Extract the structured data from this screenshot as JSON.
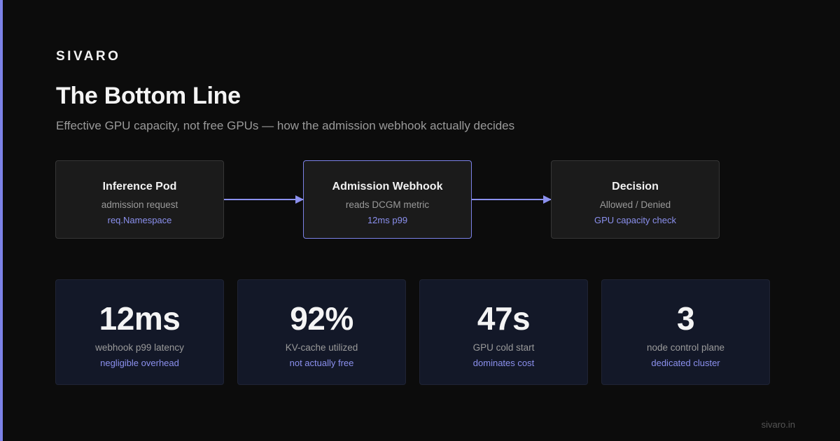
{
  "brand": "SIVARO",
  "title": "The Bottom Line",
  "subtitle": "Effective GPU capacity, not free GPUs — how the admission webhook actually decides",
  "flow": {
    "nodes": [
      {
        "title": "Inference Pod",
        "desc": "admission request",
        "note": "req.Namespace"
      },
      {
        "title": "Admission Webhook",
        "desc": "reads DCGM metric",
        "note": "12ms p99"
      },
      {
        "title": "Decision",
        "desc": "Allowed / Denied",
        "note": "GPU capacity check"
      }
    ]
  },
  "stats": [
    {
      "value": "12ms",
      "label": "webhook p99 latency",
      "note": "negligible overhead"
    },
    {
      "value": "92%",
      "label": "KV-cache utilized",
      "note": "not actually free"
    },
    {
      "value": "47s",
      "label": "GPU cold start",
      "note": "dominates cost"
    },
    {
      "value": "3",
      "label": "node control plane",
      "note": "dedicated cluster"
    }
  ],
  "footer": "sivaro.in",
  "colors": {
    "accent": "#7c82e8",
    "background": "#0c0c0c",
    "node_fill": "#1b1b1b",
    "stat_fill": "#131828"
  }
}
